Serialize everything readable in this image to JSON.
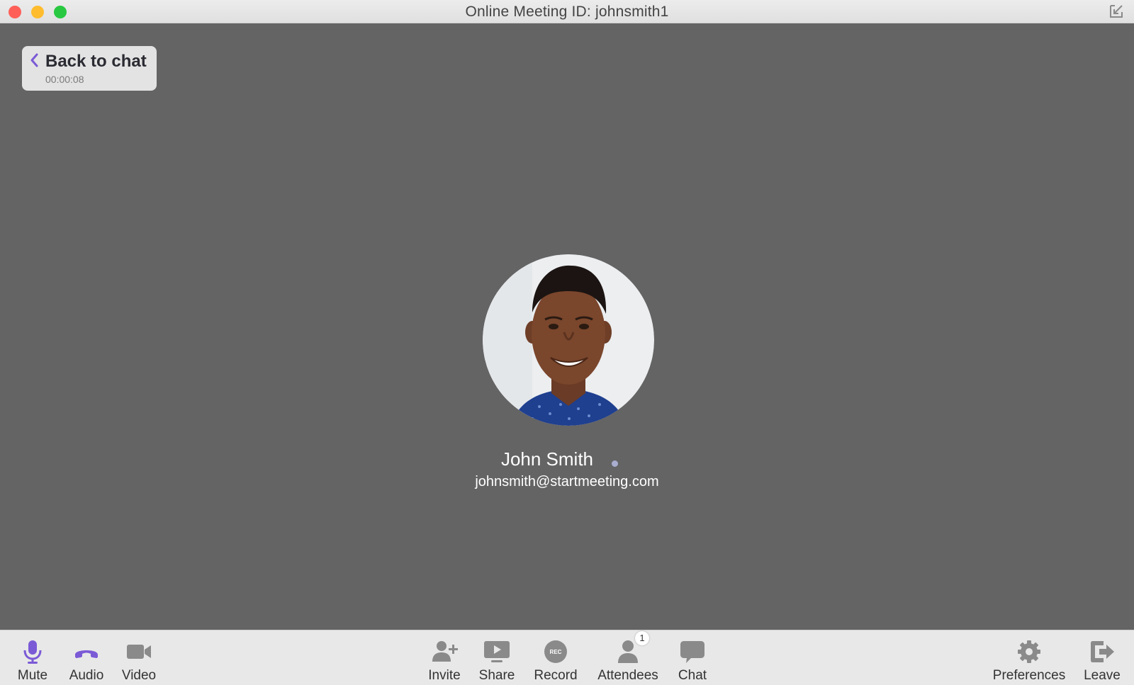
{
  "window": {
    "title": "Online Meeting ID: johnsmith1"
  },
  "back_button": {
    "label": "Back to chat",
    "timer": "00:00:08"
  },
  "participant": {
    "name": "John Smith",
    "email": "johnsmith@startmeeting.com"
  },
  "toolbar": {
    "left": [
      {
        "id": "mute",
        "label": "Mute",
        "icon": "microphone-icon",
        "color": "#7b5ad6"
      },
      {
        "id": "audio",
        "label": "Audio",
        "icon": "phone-icon",
        "color": "#7b5ad6"
      },
      {
        "id": "video",
        "label": "Video",
        "icon": "video-camera-icon",
        "color": "#8a8a8a"
      }
    ],
    "center": [
      {
        "id": "invite",
        "label": "Invite",
        "icon": "add-user-icon"
      },
      {
        "id": "share",
        "label": "Share",
        "icon": "share-screen-icon"
      },
      {
        "id": "record",
        "label": "Record",
        "icon": "record-icon",
        "icon_text": "REC"
      },
      {
        "id": "attendees",
        "label": "Attendees",
        "icon": "person-icon",
        "badge": "1"
      },
      {
        "id": "chat",
        "label": "Chat",
        "icon": "chat-bubble-icon"
      }
    ],
    "right": [
      {
        "id": "preferences",
        "label": "Preferences",
        "icon": "gear-icon"
      },
      {
        "id": "leave",
        "label": "Leave",
        "icon": "exit-icon"
      }
    ]
  },
  "colors": {
    "accent": "#7b5ad6",
    "stage": "#646464",
    "toolbar": "#e8e8e8",
    "icon_gray": "#8a8a8a"
  }
}
